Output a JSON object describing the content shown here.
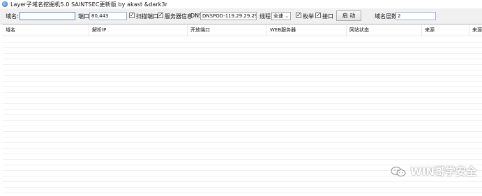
{
  "window": {
    "title": "Layer子域名挖掘机5.0 SAINTSEC更新版 by akast &dark3r"
  },
  "toolbar": {
    "domain_label": "域名:",
    "domain_value": "",
    "port_label": "端口:",
    "port_value": "80,443",
    "scan_ports_label": "扫描端口",
    "scan_ports_checked": true,
    "server_info_label": "服务器信息",
    "server_info_checked": true,
    "dns_label": "DNS:",
    "dns_value": "DNSPOD-119.29.29.29",
    "threads_label": "线程:",
    "threads_value": "全速",
    "enum_label": "枚举",
    "enum_checked": true,
    "api_label": "接口",
    "api_checked": true,
    "start_button": "启 动",
    "depth_label": "域名层数",
    "depth_value": "2"
  },
  "table": {
    "columns": [
      "域名",
      "解析IP",
      "开放端口",
      "WEB服务器",
      "网站状态",
      "来源",
      "来源"
    ],
    "rows": []
  },
  "watermark": {
    "text": "WIN哥学安全",
    "icon": "wechat-icon"
  }
}
